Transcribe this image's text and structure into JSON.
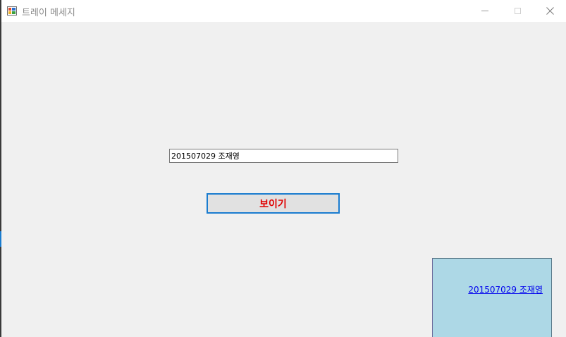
{
  "window": {
    "title": "트레이 메세지"
  },
  "titlebar_buttons": {
    "minimize": "minimize",
    "maximize": "maximize",
    "close": "close"
  },
  "form": {
    "input_value": "201507029 조재영",
    "button_label": "보이기"
  },
  "tray": {
    "link_text": "201507029 조재영"
  },
  "colors": {
    "form_background": "#f0f0f0",
    "button_text": "#e00000",
    "button_border": "#1a7ccf",
    "tray_background": "#add8e6",
    "link": "#0000ee"
  },
  "icons": {
    "app": "app-icon",
    "minimize": "minimize-icon",
    "maximize": "maximize-icon",
    "close": "close-icon"
  }
}
